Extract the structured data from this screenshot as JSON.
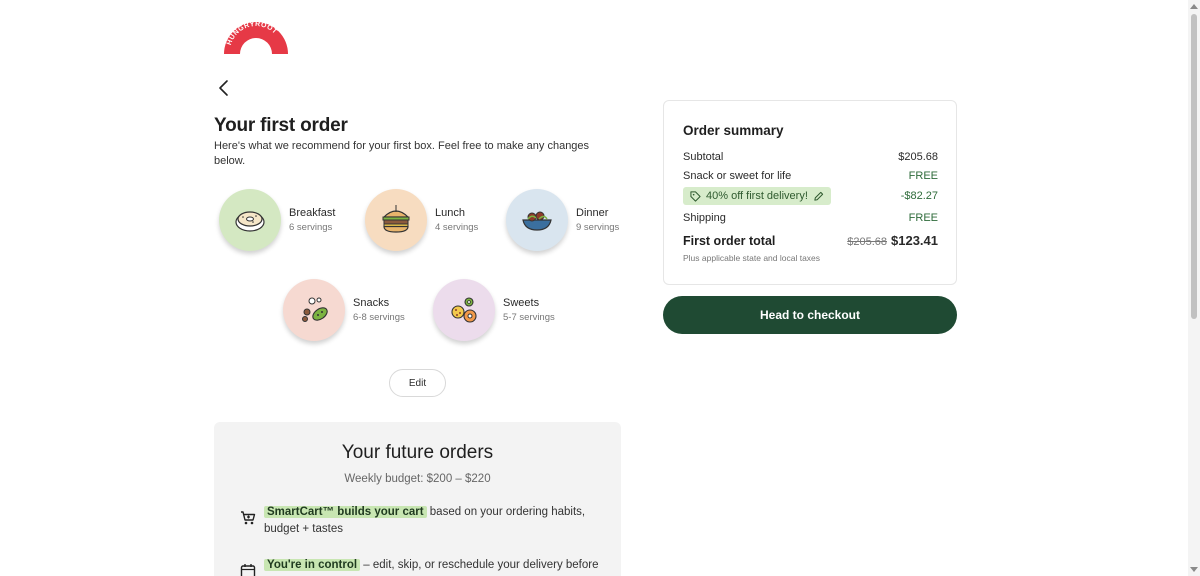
{
  "brand": {
    "logo_text": "HUNGRYROOT",
    "logo_color": "#e63946"
  },
  "page": {
    "title": "Your first order",
    "subtitle": "Here's what we recommend for your first box. Feel free to make any changes below."
  },
  "categories": [
    {
      "name": "Breakfast",
      "servings": "6 servings",
      "icon": "bagel-icon",
      "color": "#d4e8c2"
    },
    {
      "name": "Lunch",
      "servings": "4 servings",
      "icon": "sandwich-icon",
      "color": "#f7dcc0"
    },
    {
      "name": "Dinner",
      "servings": "9 servings",
      "icon": "bowl-icon",
      "color": "#d9e5ef"
    },
    {
      "name": "Snacks",
      "servings": "6-8 servings",
      "icon": "snacks-icon",
      "color": "#f6d9d1"
    },
    {
      "name": "Sweets",
      "servings": "5-7 servings",
      "icon": "cookies-icon",
      "color": "#ecdcec"
    }
  ],
  "edit_label": "Edit",
  "future_orders": {
    "title": "Your future orders",
    "budget": "Weekly budget: $200 – $220",
    "features": [
      {
        "icon": "cart-icon",
        "highlight": "SmartCart™ builds your cart",
        "text": " based on your ordering habits, budget + tastes"
      },
      {
        "icon": "calendar-icon",
        "highlight": "You're in control",
        "text": " – edit, skip, or reschedule your delivery before"
      }
    ]
  },
  "summary": {
    "title": "Order summary",
    "subtotal_label": "Subtotal",
    "subtotal_value": "$205.68",
    "snack_label": "Snack or sweet for life",
    "snack_value": "FREE",
    "promo_label": "40% off first delivery!",
    "promo_value": "-$82.27",
    "shipping_label": "Shipping",
    "shipping_value": "FREE",
    "total_label": "First order total",
    "total_original": "$205.68",
    "total_value": "$123.41",
    "tax_note": "Plus applicable state and local taxes"
  },
  "checkout_label": "Head to checkout",
  "colors": {
    "accent": "#1f4a33",
    "highlight": "#c8e6b2",
    "free": "#2e6b3a"
  }
}
